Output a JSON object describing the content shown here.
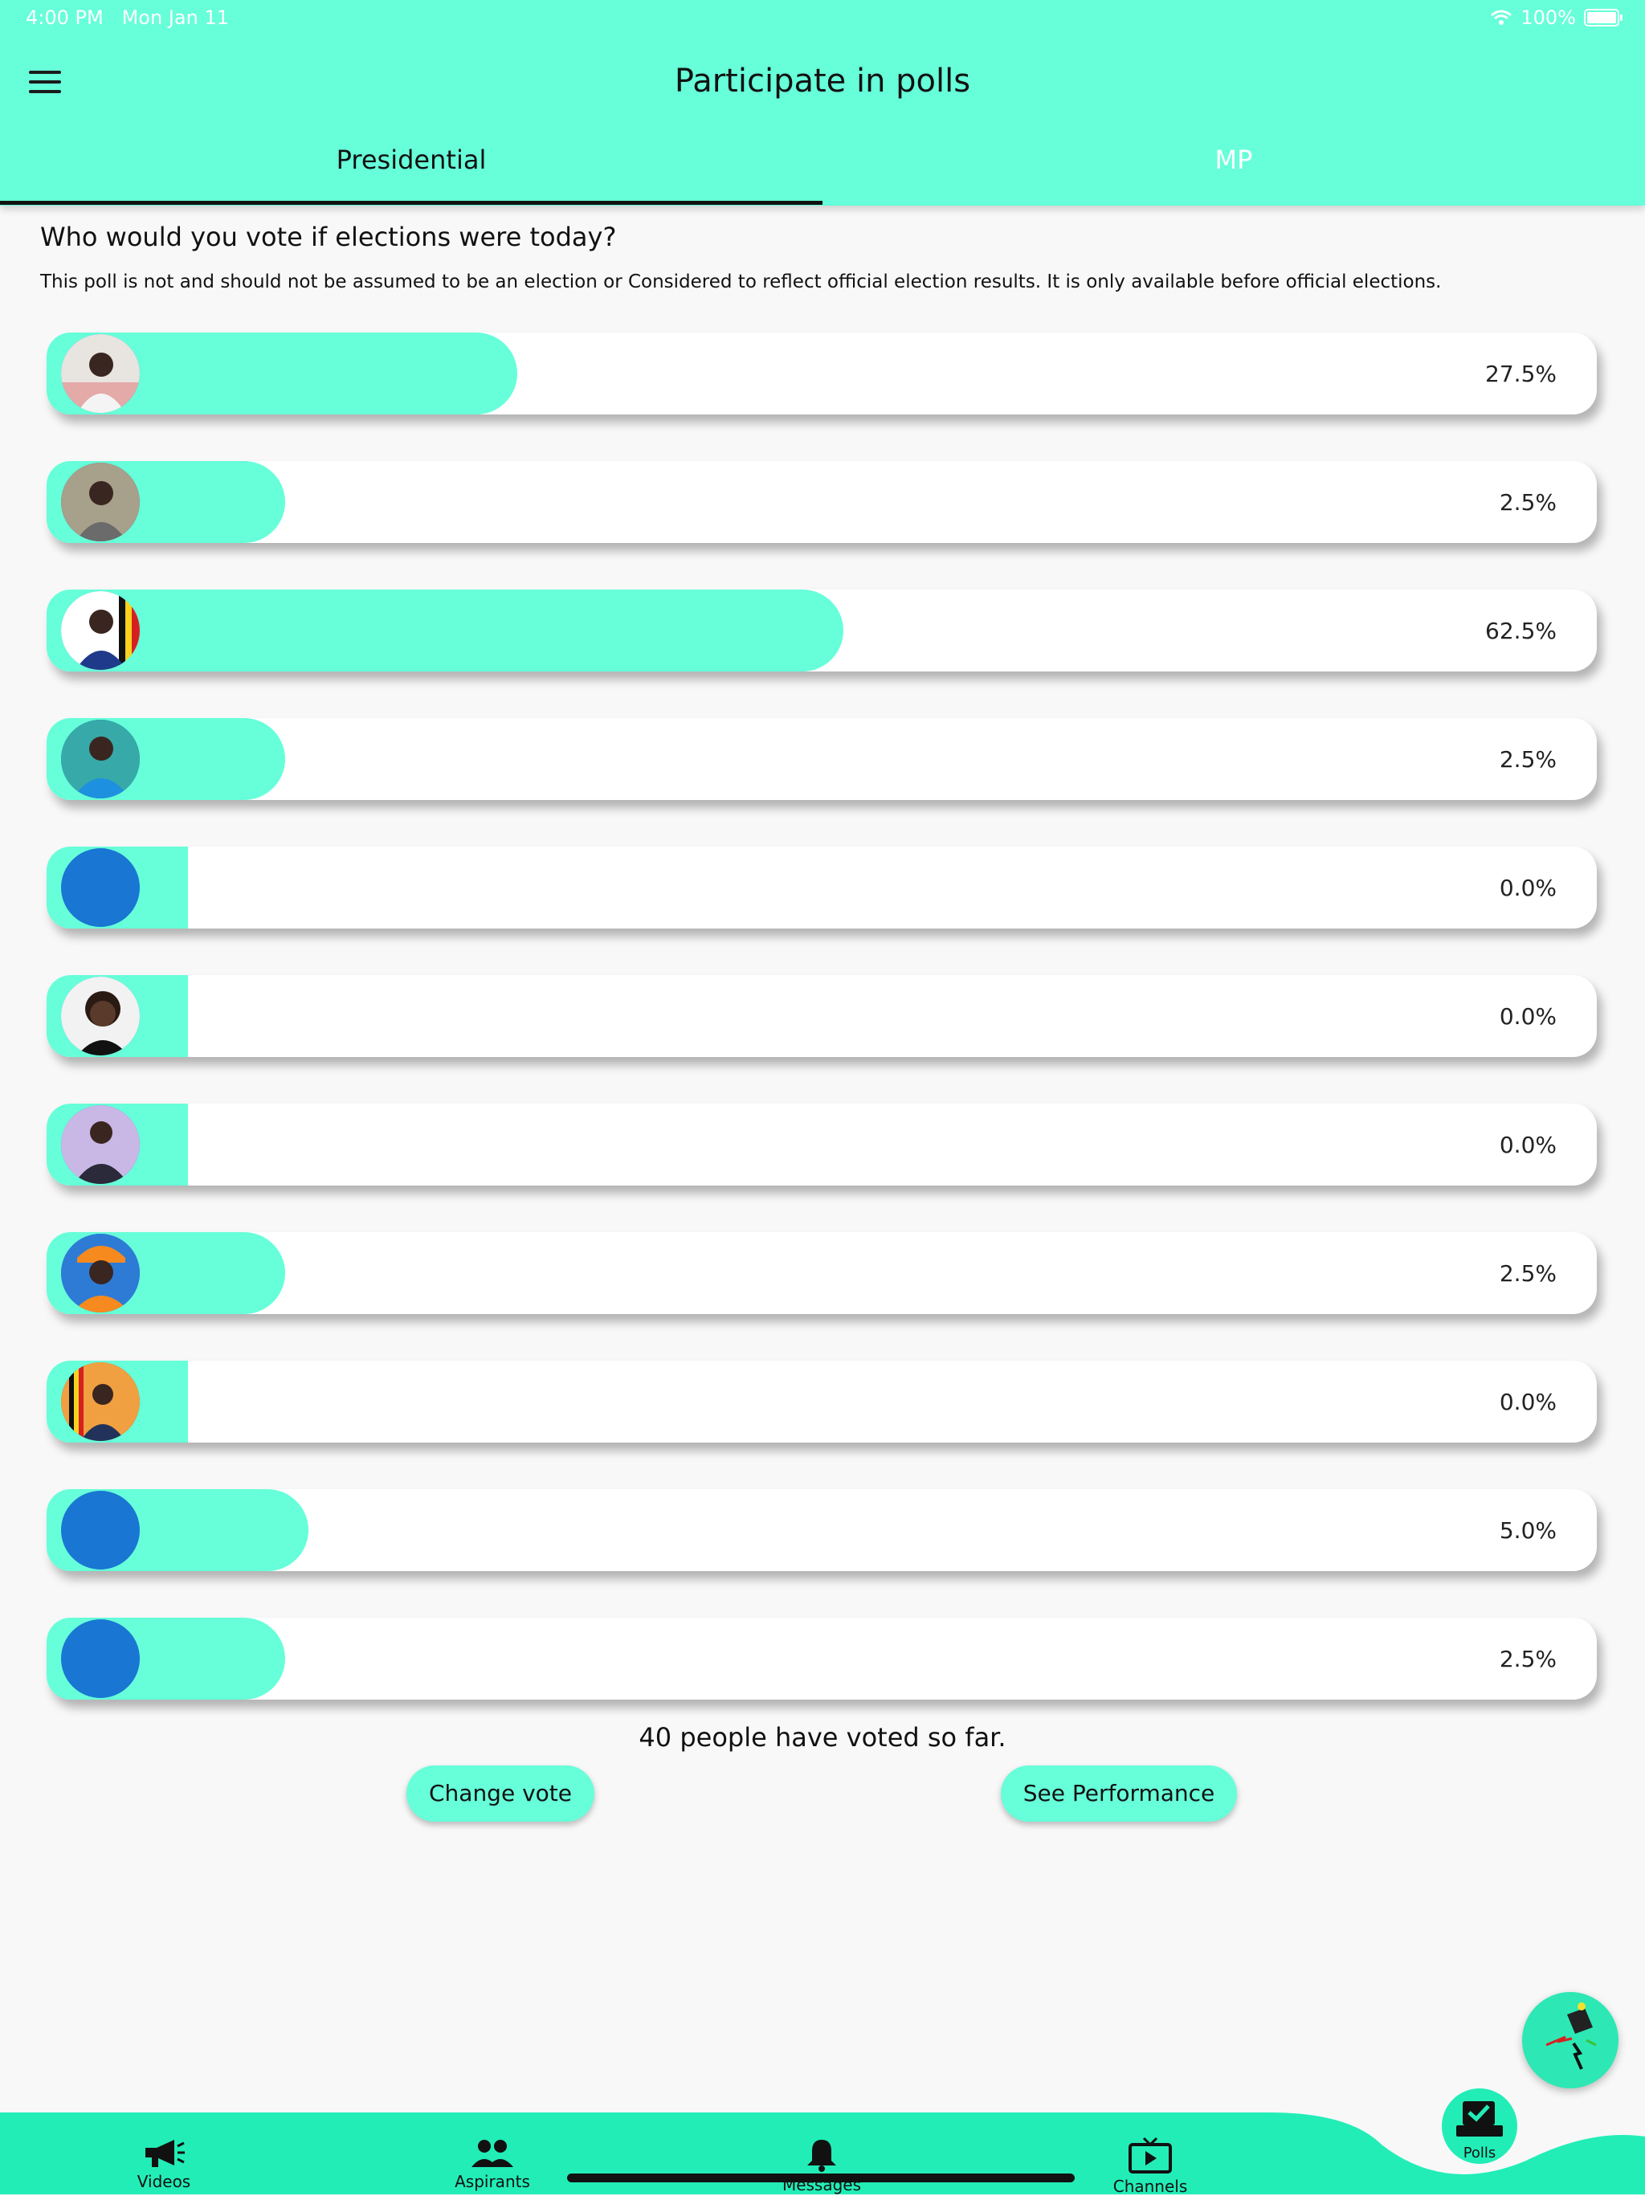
{
  "status_bar": {
    "time": "4:00 PM",
    "date": "Mon Jan 11",
    "battery": "100%"
  },
  "header": {
    "title": "Participate in polls"
  },
  "tabs": [
    {
      "label": "Presidential",
      "active": true
    },
    {
      "label": "MP",
      "active": false
    }
  ],
  "question": "Who would you vote if elections were today?",
  "disclaimer": "This poll is not and should not be assumed to be an election or Considered to reflect official election results. It is only available before official elections.",
  "poll": {
    "options": [
      {
        "percent_label": "27.5%",
        "fraction": 0.275,
        "avatar": "photo"
      },
      {
        "percent_label": "2.5%",
        "fraction": 0.025,
        "avatar": "photo"
      },
      {
        "percent_label": "62.5%",
        "fraction": 0.625,
        "avatar": "photo"
      },
      {
        "percent_label": "2.5%",
        "fraction": 0.025,
        "avatar": "photo"
      },
      {
        "percent_label": "0.0%",
        "fraction": 0.0,
        "avatar": "placeholder"
      },
      {
        "percent_label": "0.0%",
        "fraction": 0.0,
        "avatar": "photo"
      },
      {
        "percent_label": "0.0%",
        "fraction": 0.0,
        "avatar": "photo"
      },
      {
        "percent_label": "2.5%",
        "fraction": 0.025,
        "avatar": "photo"
      },
      {
        "percent_label": "0.0%",
        "fraction": 0.0,
        "avatar": "photo"
      },
      {
        "percent_label": "5.0%",
        "fraction": 0.05,
        "avatar": "placeholder"
      },
      {
        "percent_label": "2.5%",
        "fraction": 0.025,
        "avatar": "placeholder"
      }
    ]
  },
  "vote_count_text": "40 people have voted so far.",
  "actions": {
    "change_vote": "Change vote",
    "see_performance": "See Performance"
  },
  "bottom_nav": [
    {
      "label": "Videos",
      "icon": "megaphone-icon"
    },
    {
      "label": "Aspirants",
      "icon": "people-icon"
    },
    {
      "label": "Messages",
      "icon": "bell-icon"
    },
    {
      "label": "Channels",
      "icon": "tv-play-icon"
    },
    {
      "label": "Polls",
      "icon": "ballot-box-icon",
      "active": true
    }
  ],
  "colors": {
    "accent": "#66ffd9",
    "nav": "#22edb7",
    "placeholder_avatar": "#1976d2",
    "text": "#111111"
  }
}
